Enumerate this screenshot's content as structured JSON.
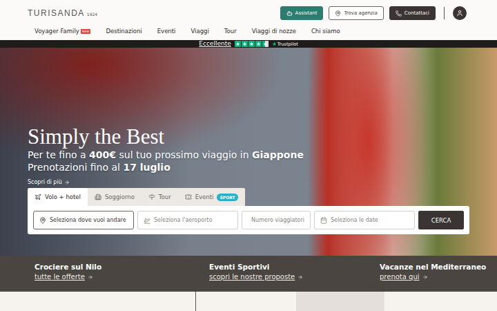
{
  "header": {
    "logo": "TURISANDA",
    "logo_year": "1924",
    "buttons": [
      {
        "label": "Assistant",
        "kind": "teal"
      },
      {
        "label": "Trova agenzia",
        "kind": "outline"
      },
      {
        "label": "Contattaci",
        "kind": "dark"
      }
    ]
  },
  "nav": [
    {
      "label": "Voyager Family",
      "badge": "NEW"
    },
    {
      "label": "Destinazioni",
      "badge": ""
    },
    {
      "label": "Eventi",
      "badge": ""
    },
    {
      "label": "Viaggi",
      "badge": ""
    },
    {
      "label": "Tour",
      "badge": ""
    },
    {
      "label": "Viaggi di nozze",
      "badge": ""
    },
    {
      "label": "Chi siamo",
      "badge": ""
    }
  ],
  "trustpilot": {
    "rating": "Eccellente",
    "stars": 4.5,
    "brand": "Trustpilot"
  },
  "hero": {
    "title": "Simply the Best",
    "lines": [
      [
        {
          "text": "Per te fino a ",
          "bold": false
        },
        {
          "text": "400€",
          "bold": true
        },
        {
          "text": " sul tuo prossimo viaggio in ",
          "bold": false
        },
        {
          "text": "Giappone",
          "bold": true
        }
      ],
      [
        {
          "text": "Prenotazioni fino al ",
          "bold": false
        },
        {
          "text": "17 luglio",
          "bold": true
        }
      ]
    ],
    "link": "Scopri di più"
  },
  "tabs": [
    {
      "label": "Volo + hotel",
      "selected": true,
      "badge": ""
    },
    {
      "label": "Soggiorno",
      "selected": false,
      "badge": ""
    },
    {
      "label": "Tour",
      "selected": false,
      "badge": ""
    },
    {
      "label": "Eventi",
      "selected": false,
      "badge": "SPORT"
    }
  ],
  "search": {
    "fields": [
      {
        "placeholder": "Seleziona dove vuoi andare",
        "focused": true
      },
      {
        "placeholder": "Seleziona l'aeroporto",
        "focused": false
      },
      {
        "placeholder": "Numero viaggiatori",
        "focused": false
      },
      {
        "placeholder": "Seleziona le date",
        "focused": false
      }
    ],
    "button": "CERCA"
  },
  "promos": [
    {
      "title": "Crociere sul Nilo",
      "link": "tutte le offerte"
    },
    {
      "title": "Eventi Sportivi",
      "link": "scopri le nostre proposte"
    },
    {
      "title": "Vacanze nel Mediterraneo",
      "link": "prenota qui"
    }
  ]
}
